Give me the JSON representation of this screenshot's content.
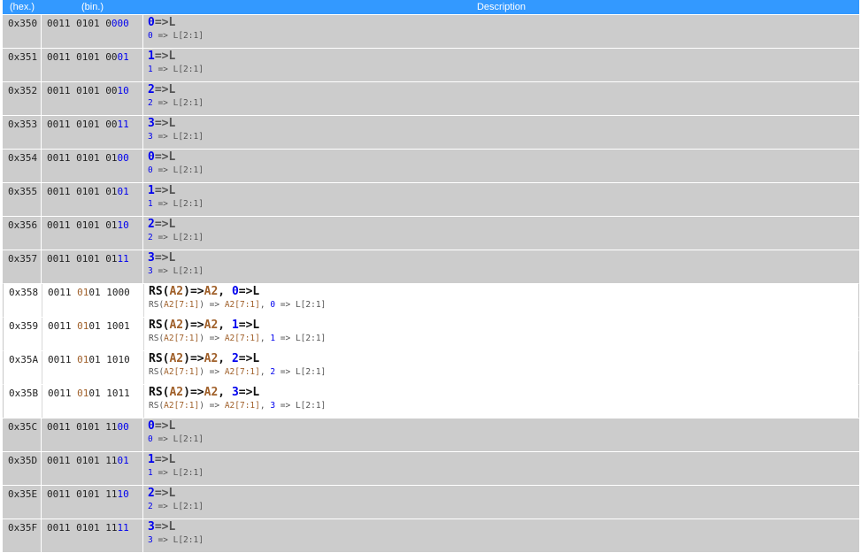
{
  "headers": {
    "hex": "(hex.)",
    "bin": "(bin.)",
    "desc": "Description"
  },
  "colors": {
    "header_bg": "#3399ff",
    "row_grey": "#cccccc",
    "row_white": "#ffffff",
    "blue": "#0000ee",
    "brown": "#a0602a"
  },
  "rows": [
    {
      "hex": "0x350",
      "bin": [
        [
          "0011 0101 0",
          ""
        ],
        [
          "000",
          "blue"
        ]
      ],
      "main": [
        [
          "0",
          "blue"
        ],
        [
          "=>L",
          "gray"
        ]
      ],
      "sub": [
        [
          "0",
          "blue"
        ],
        [
          " => L[2:1]",
          "gray"
        ]
      ],
      "style": "grey"
    },
    {
      "hex": "0x351",
      "bin": [
        [
          "0011 0101 00",
          ""
        ],
        [
          "01",
          "blue"
        ]
      ],
      "main": [
        [
          "1",
          "blue"
        ],
        [
          "=>L",
          "gray"
        ]
      ],
      "sub": [
        [
          "1",
          "blue"
        ],
        [
          " => L[2:1]",
          "gray"
        ]
      ],
      "style": "grey"
    },
    {
      "hex": "0x352",
      "bin": [
        [
          "0011 0101 00",
          ""
        ],
        [
          "10",
          "blue"
        ]
      ],
      "main": [
        [
          "2",
          "blue"
        ],
        [
          "=>L",
          "gray"
        ]
      ],
      "sub": [
        [
          "2",
          "blue"
        ],
        [
          " => L[2:1]",
          "gray"
        ]
      ],
      "style": "grey"
    },
    {
      "hex": "0x353",
      "bin": [
        [
          "0011 0101 00",
          ""
        ],
        [
          "11",
          "blue"
        ]
      ],
      "main": [
        [
          "3",
          "blue"
        ],
        [
          "=>L",
          "gray"
        ]
      ],
      "sub": [
        [
          "3",
          "blue"
        ],
        [
          " => L[2:1]",
          "gray"
        ]
      ],
      "style": "grey"
    },
    {
      "hex": "0x354",
      "bin": [
        [
          "0011 0101 01",
          ""
        ],
        [
          "00",
          "blue"
        ]
      ],
      "main": [
        [
          "0",
          "blue"
        ],
        [
          "=>L",
          "gray"
        ]
      ],
      "sub": [
        [
          "0",
          "blue"
        ],
        [
          " => L[2:1]",
          "gray"
        ]
      ],
      "style": "grey"
    },
    {
      "hex": "0x355",
      "bin": [
        [
          "0011 0101 01",
          ""
        ],
        [
          "01",
          "blue"
        ]
      ],
      "main": [
        [
          "1",
          "blue"
        ],
        [
          "=>L",
          "gray"
        ]
      ],
      "sub": [
        [
          "1",
          "blue"
        ],
        [
          " => L[2:1]",
          "gray"
        ]
      ],
      "style": "grey"
    },
    {
      "hex": "0x356",
      "bin": [
        [
          "0011 0101 01",
          ""
        ],
        [
          "10",
          "blue"
        ]
      ],
      "main": [
        [
          "2",
          "blue"
        ],
        [
          "=>L",
          "gray"
        ]
      ],
      "sub": [
        [
          "2",
          "blue"
        ],
        [
          " => L[2:1]",
          "gray"
        ]
      ],
      "style": "grey"
    },
    {
      "hex": "0x357",
      "bin": [
        [
          "0011 0101 01",
          ""
        ],
        [
          "11",
          "blue"
        ]
      ],
      "main": [
        [
          "3",
          "blue"
        ],
        [
          "=>L",
          "gray"
        ]
      ],
      "sub": [
        [
          "3",
          "blue"
        ],
        [
          " => L[2:1]",
          "gray"
        ]
      ],
      "style": "grey"
    },
    {
      "hex": "0x358",
      "bin": [
        [
          "0011 ",
          ""
        ],
        [
          "01",
          "brown"
        ],
        [
          "01 1000",
          ""
        ]
      ],
      "main": [
        [
          "RS(",
          "black"
        ],
        [
          "A2",
          "brown"
        ],
        [
          ")=>",
          "black"
        ],
        [
          "A2",
          "brown"
        ],
        [
          ", ",
          "black"
        ],
        [
          "0",
          "blue"
        ],
        [
          "=>L",
          "black"
        ]
      ],
      "sub": [
        [
          "RS(",
          ""
        ],
        [
          "A2[7:1]",
          "brown"
        ],
        [
          ") => ",
          ""
        ],
        [
          "A2[7:1]",
          "brown"
        ],
        [
          ", ",
          ""
        ],
        [
          "0",
          "blue"
        ],
        [
          " => L[2:1]",
          ""
        ]
      ],
      "style": "white"
    },
    {
      "hex": "0x359",
      "bin": [
        [
          "0011 ",
          ""
        ],
        [
          "01",
          "brown"
        ],
        [
          "01 1001",
          ""
        ]
      ],
      "main": [
        [
          "RS(",
          "black"
        ],
        [
          "A2",
          "brown"
        ],
        [
          ")=>",
          "black"
        ],
        [
          "A2",
          "brown"
        ],
        [
          ", ",
          "black"
        ],
        [
          "1",
          "blue"
        ],
        [
          "=>L",
          "black"
        ]
      ],
      "sub": [
        [
          "RS(",
          ""
        ],
        [
          "A2[7:1]",
          "brown"
        ],
        [
          ") => ",
          ""
        ],
        [
          "A2[7:1]",
          "brown"
        ],
        [
          ", ",
          ""
        ],
        [
          "1",
          "blue"
        ],
        [
          " => L[2:1]",
          ""
        ]
      ],
      "style": "white"
    },
    {
      "hex": "0x35A",
      "bin": [
        [
          "0011 ",
          ""
        ],
        [
          "01",
          "brown"
        ],
        [
          "01 1010",
          ""
        ]
      ],
      "main": [
        [
          "RS(",
          "black"
        ],
        [
          "A2",
          "brown"
        ],
        [
          ")=>",
          "black"
        ],
        [
          "A2",
          "brown"
        ],
        [
          ", ",
          "black"
        ],
        [
          "2",
          "blue"
        ],
        [
          "=>L",
          "black"
        ]
      ],
      "sub": [
        [
          "RS(",
          ""
        ],
        [
          "A2[7:1]",
          "brown"
        ],
        [
          ") => ",
          ""
        ],
        [
          "A2[7:1]",
          "brown"
        ],
        [
          ", ",
          ""
        ],
        [
          "2",
          "blue"
        ],
        [
          " => L[2:1]",
          ""
        ]
      ],
      "style": "white"
    },
    {
      "hex": "0x35B",
      "bin": [
        [
          "0011 ",
          ""
        ],
        [
          "01",
          "brown"
        ],
        [
          "01 1011",
          ""
        ]
      ],
      "main": [
        [
          "RS(",
          "black"
        ],
        [
          "A2",
          "brown"
        ],
        [
          ")=>",
          "black"
        ],
        [
          "A2",
          "brown"
        ],
        [
          ", ",
          "black"
        ],
        [
          "3",
          "blue"
        ],
        [
          "=>L",
          "black"
        ]
      ],
      "sub": [
        [
          "RS(",
          ""
        ],
        [
          "A2[7:1]",
          "brown"
        ],
        [
          ") => ",
          ""
        ],
        [
          "A2[7:1]",
          "brown"
        ],
        [
          ", ",
          ""
        ],
        [
          "3",
          "blue"
        ],
        [
          " => L[2:1]",
          ""
        ]
      ],
      "style": "white"
    },
    {
      "hex": "0x35C",
      "bin": [
        [
          "0011 0101 11",
          ""
        ],
        [
          "00",
          "blue"
        ]
      ],
      "main": [
        [
          "0",
          "blue"
        ],
        [
          "=>L",
          "gray"
        ]
      ],
      "sub": [
        [
          "0",
          "blue"
        ],
        [
          " => L[2:1]",
          "gray"
        ]
      ],
      "style": "grey"
    },
    {
      "hex": "0x35D",
      "bin": [
        [
          "0011 0101 11",
          ""
        ],
        [
          "01",
          "blue"
        ]
      ],
      "main": [
        [
          "1",
          "blue"
        ],
        [
          "=>L",
          "gray"
        ]
      ],
      "sub": [
        [
          "1",
          "blue"
        ],
        [
          " => L[2:1]",
          "gray"
        ]
      ],
      "style": "grey"
    },
    {
      "hex": "0x35E",
      "bin": [
        [
          "0011 0101 11",
          ""
        ],
        [
          "10",
          "blue"
        ]
      ],
      "main": [
        [
          "2",
          "blue"
        ],
        [
          "=>L",
          "gray"
        ]
      ],
      "sub": [
        [
          "2",
          "blue"
        ],
        [
          " => L[2:1]",
          "gray"
        ]
      ],
      "style": "grey"
    },
    {
      "hex": "0x35F",
      "bin": [
        [
          "0011 0101 11",
          ""
        ],
        [
          "11",
          "blue"
        ]
      ],
      "main": [
        [
          "3",
          "blue"
        ],
        [
          "=>L",
          "gray"
        ]
      ],
      "sub": [
        [
          "3",
          "blue"
        ],
        [
          " => L[2:1]",
          "gray"
        ]
      ],
      "style": "grey"
    }
  ]
}
